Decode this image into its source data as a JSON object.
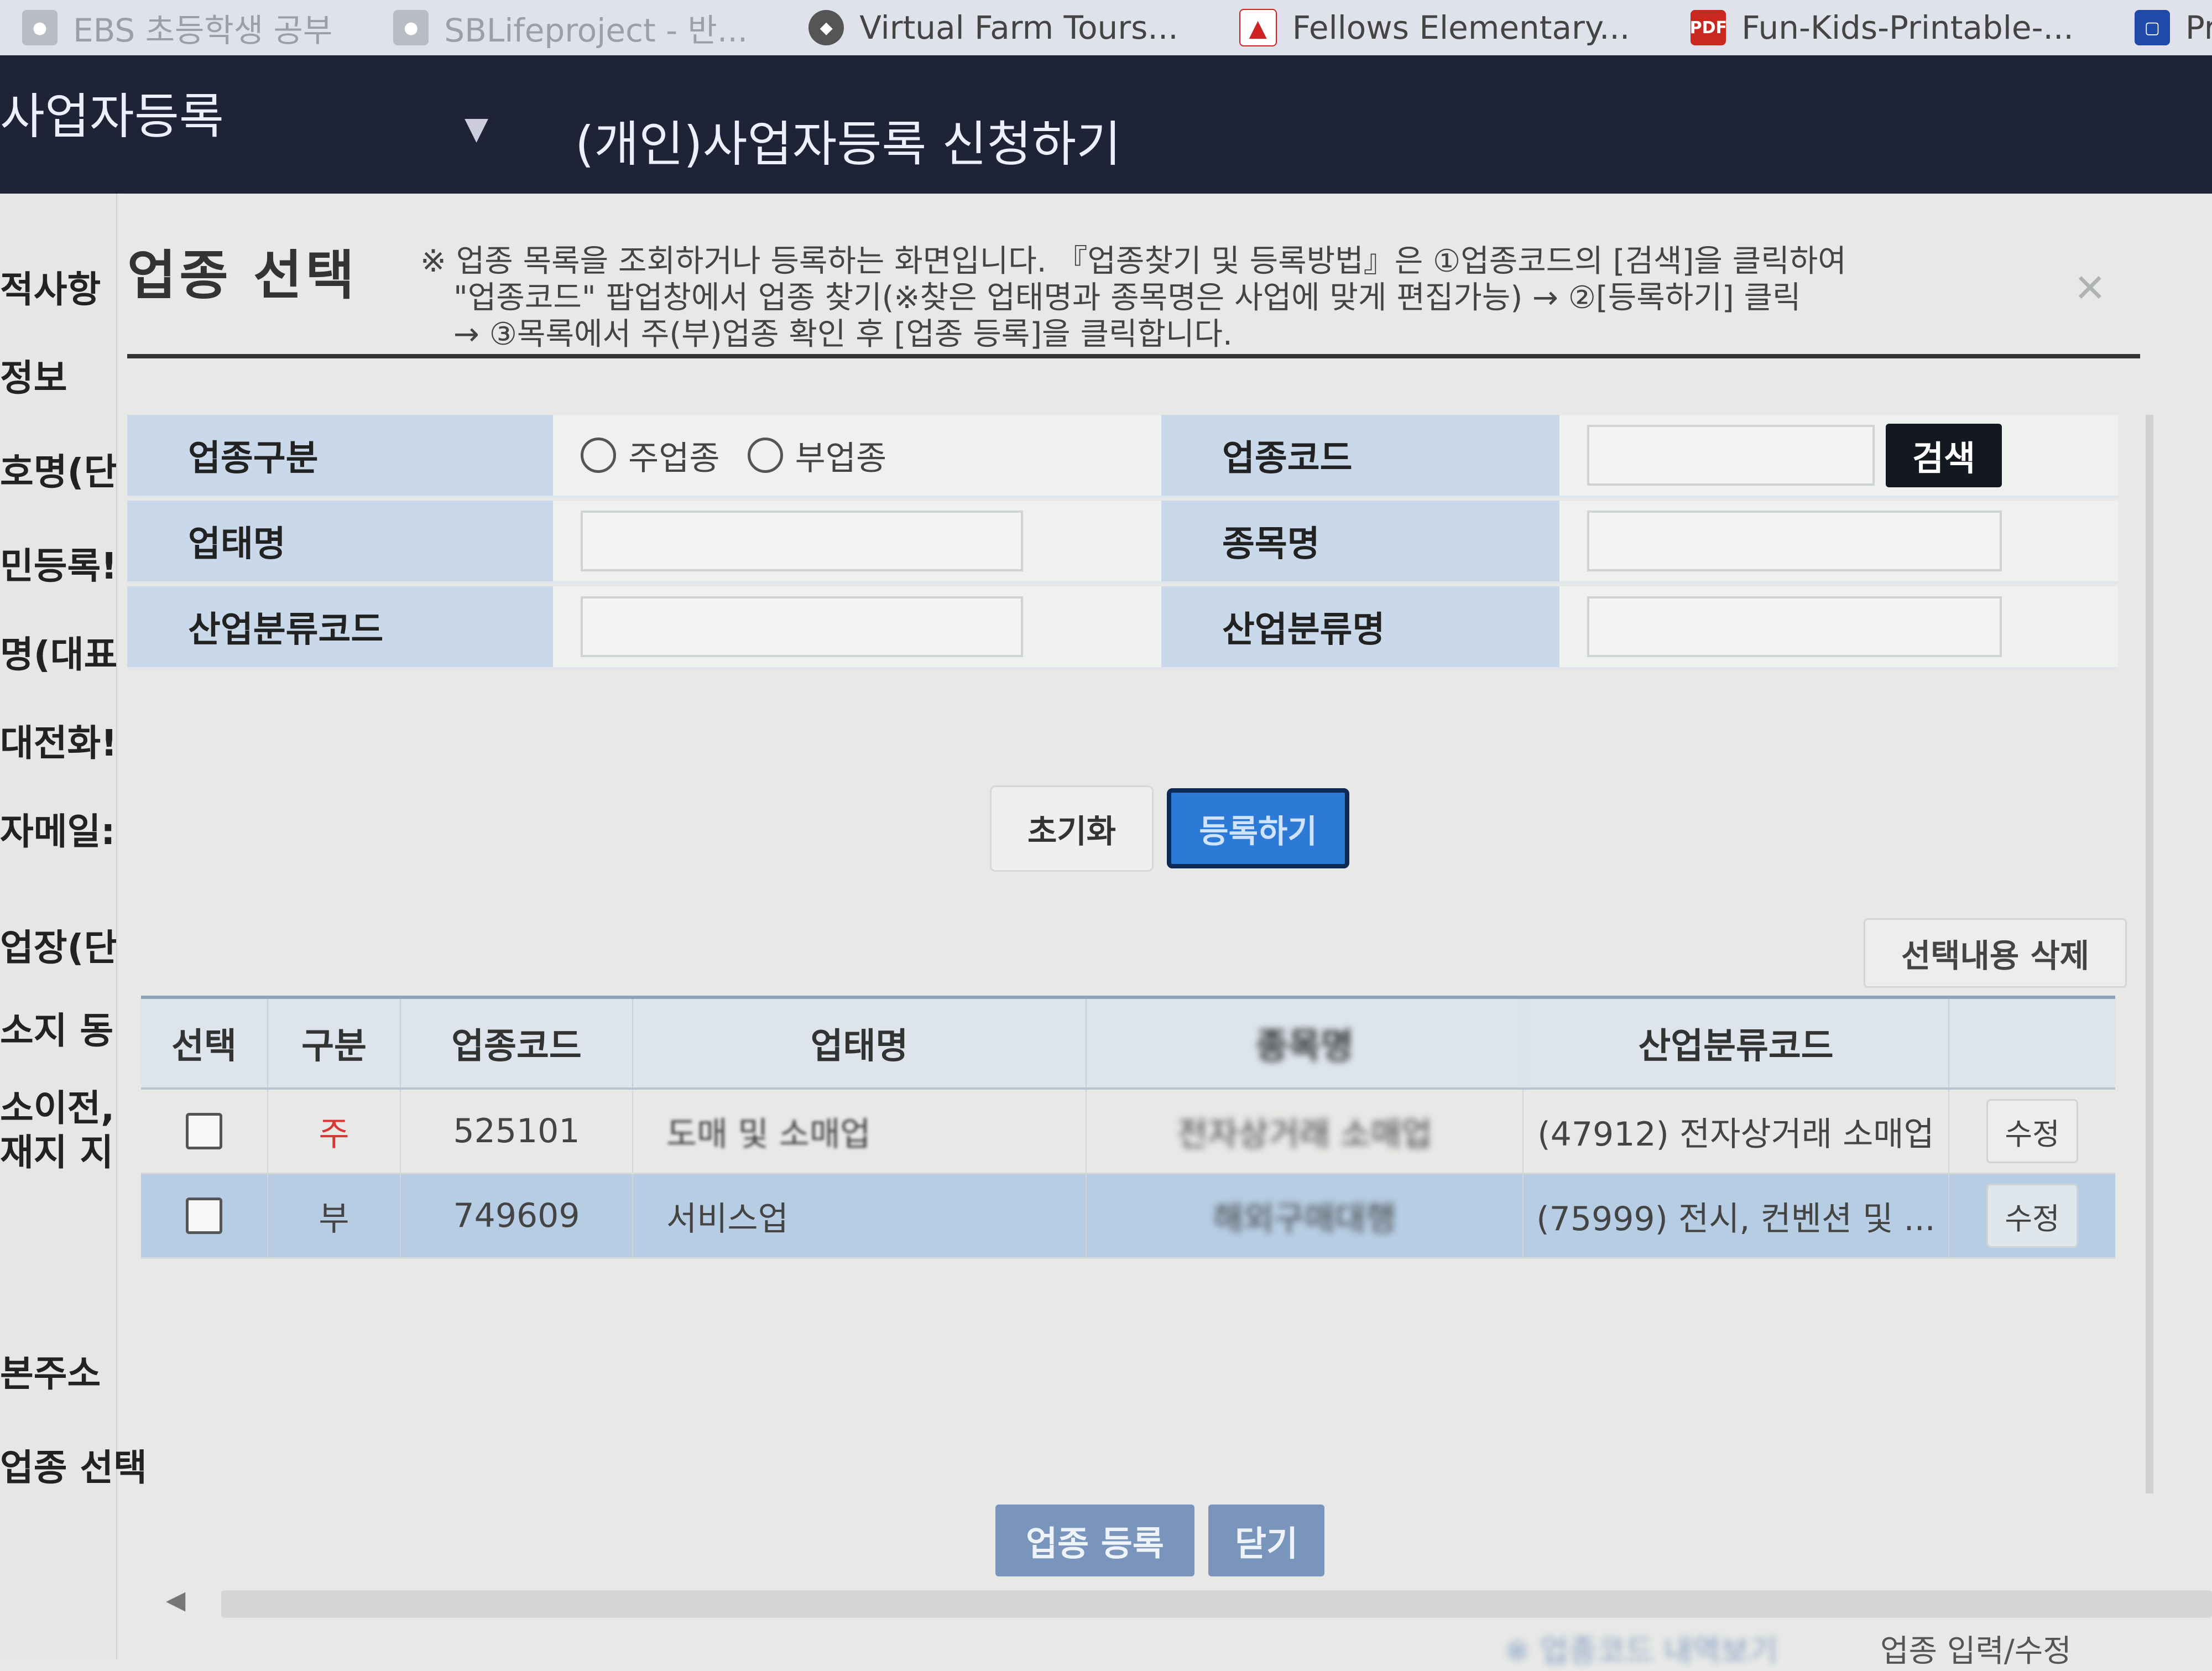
{
  "bookmarks": [
    {
      "label": "EBS 초등학생 공부",
      "icon": "globe-icon",
      "faded": true
    },
    {
      "label": "SBLifeproject - 반...",
      "icon": "globe-icon",
      "faded": true
    },
    {
      "label": "Virtual Farm Tours...",
      "icon": "cow-icon",
      "faded": false
    },
    {
      "label": "Fellows Elementary...",
      "icon": "triangle-logo-icon",
      "faded": false
    },
    {
      "label": "Fun-Kids-Printable-...",
      "icon": "pdf-icon",
      "icon_text": "PDF",
      "faded": false
    },
    {
      "label": "Printab",
      "icon": "chat-icon",
      "faded": false
    }
  ],
  "header": {
    "menu_label": "사업자등록",
    "page_title": "(개인)사업자등록 신청하기"
  },
  "leftnav": {
    "items": [
      "적사항",
      "정보",
      "호명(단",
      "민등록!",
      "명(대표",
      "대전화!",
      "자메일:",
      "업장(단)",
      "소지 동",
      "소이전,",
      "재지 지",
      "본주소"
    ],
    "bottom_label": "업종 선택"
  },
  "modal": {
    "title": "업종 선택",
    "note_lines": [
      "※ 업종 목록을 조회하거나 등록하는 화면입니다. 『업종찾기 및 등록방법』은 ①업종코드의 [검색]을 클릭하여",
      "\"업종코드\" 팝업창에서 업종 찾기(※찾은 업태명과 종목명은 사업에 맞게 편집가능) → ②[등록하기] 클릭",
      "→ ③목록에서 주(부)업종 확인 후 [업종 등록]을 클릭합니다."
    ],
    "close_glyph": "✕"
  },
  "form": {
    "type_label": "업종구분",
    "type_options": [
      "주업종",
      "부업종"
    ],
    "business_type_label": "업태명",
    "business_type_value": "",
    "industry_code_label": "산업분류코드",
    "industry_code_value": "",
    "code_label": "업종코드",
    "code_value": "",
    "search_button": "검색",
    "item_label": "종목명",
    "item_value": "",
    "industry_name_label": "산업분류명",
    "industry_name_value": ""
  },
  "actions": {
    "reset": "초기화",
    "register": "등록하기",
    "delete_selected": "선택내용 삭제"
  },
  "table": {
    "columns": [
      "선택",
      "구분",
      "업종코드",
      "업태명",
      "종목명",
      "산업분류코드",
      ""
    ],
    "rows": [
      {
        "type": "주",
        "code": "525101",
        "business": "도매 및 소매업",
        "item": "전자상거래 소매업",
        "industry": "(47912) 전자상거래 소매업",
        "edit": "수정",
        "selected": false
      },
      {
        "type": "부",
        "code": "749609",
        "business": "서비스업",
        "item": "해외구매대행",
        "industry": "(75999) 전시, 컨벤션 및 ...",
        "edit": "수정",
        "selected": true
      }
    ]
  },
  "bottom": {
    "register_button": "업종 등록",
    "close_button": "닫기",
    "footer_right": "업종 입력/수정",
    "footer_blur": "※ 업종코드 내역보기"
  },
  "colors": {
    "header_bg": "#1e2436",
    "label_bg": "#c9d9ea",
    "primary_blue": "#2d7ad6",
    "selected_row": "#b6cde3",
    "main_type_red": "#d33"
  }
}
